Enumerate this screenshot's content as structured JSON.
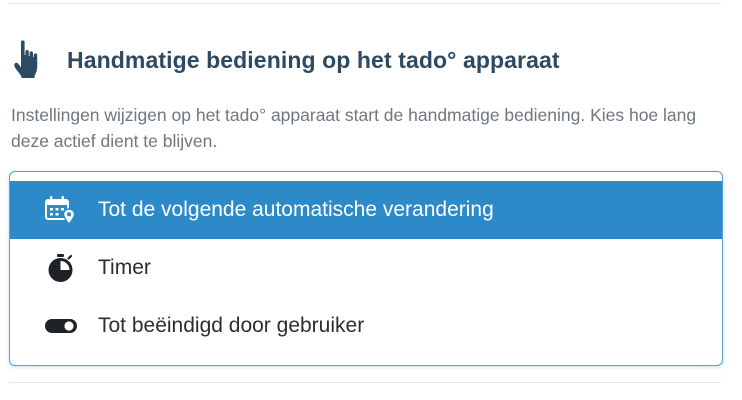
{
  "section": {
    "icon": "hand-pointer-icon",
    "title": "Handmatige bediening op het tado° apparaat",
    "description": "Instellingen wijzigen op het tado° apparaat start de handmatige bediening. Kies hoe lang deze actief dient te blijven."
  },
  "options": [
    {
      "label": "Tot de volgende automatische verandering",
      "icon": "calendar-location-icon",
      "selected": true
    },
    {
      "label": "Timer",
      "icon": "stopwatch-icon",
      "selected": false
    },
    {
      "label": "Tot beëindigd door gebruiker",
      "icon": "toggle-icon",
      "selected": false
    }
  ],
  "colors": {
    "accent": "#2d8ac9",
    "title": "#2e4a63",
    "text": "#6f7780",
    "border": "#56a1d6"
  }
}
